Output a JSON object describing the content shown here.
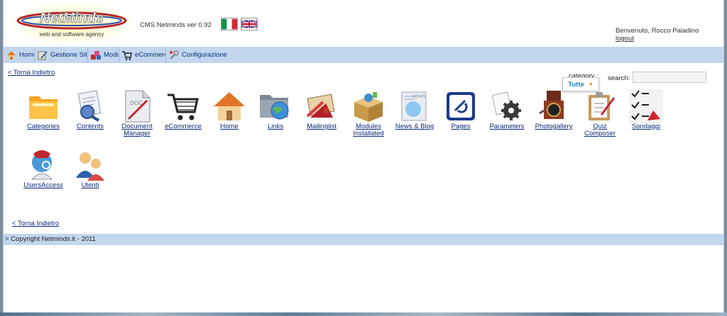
{
  "header": {
    "brand_logo_text": "NetMinds",
    "brand_tagline": "web and software agency",
    "cms_version": "CMS Netminds ver 0.92",
    "welcome_text": "Benvenuto, Rocco Paladino",
    "logout_label": "logout"
  },
  "nav": {
    "items": [
      {
        "label": "Home",
        "icon": "home-icon"
      },
      {
        "label": "Gestione Sito",
        "icon": "edit-icon"
      },
      {
        "label": "Moduli",
        "icon": "modules-icon"
      },
      {
        "label": "eCommerce",
        "icon": "cart-icon"
      },
      {
        "label": "Configurazione",
        "icon": "config-icon"
      }
    ]
  },
  "back_link": "< Torna Indietro",
  "filters": {
    "category_label": "category :",
    "category_value": "Tutte",
    "search_label": "search:",
    "search_value": ""
  },
  "modules": [
    {
      "label": "Categories",
      "icon": "folder-icon"
    },
    {
      "label": "Contents",
      "icon": "contents-icon"
    },
    {
      "label": "Document Manager",
      "icon": "document-icon"
    },
    {
      "label": "eCommerce",
      "icon": "cart-icon"
    },
    {
      "label": "Home",
      "icon": "home-icon"
    },
    {
      "label": "Links",
      "icon": "globe-folder-icon"
    },
    {
      "label": "Mailinglist",
      "icon": "mail-icon"
    },
    {
      "label": "Modules Installated",
      "icon": "box-icon"
    },
    {
      "label": "News & Blog",
      "icon": "news-icon"
    },
    {
      "label": "Pages",
      "icon": "pages-icon"
    },
    {
      "label": "Parameters",
      "icon": "gear-icon"
    },
    {
      "label": "Photogallery",
      "icon": "camera-icon"
    },
    {
      "label": "Quiz Composer",
      "icon": "clipboard-icon"
    },
    {
      "label": "Sondaggi",
      "icon": "checklist-icon"
    },
    {
      "label": "UsersAccess",
      "icon": "user-access-icon"
    },
    {
      "label": "Utenti",
      "icon": "users-icon"
    }
  ],
  "footer": {
    "copyright": "> Copyright Netminds.it - 2011"
  },
  "colors": {
    "nav_bg": "#c2d6ee",
    "link": "#0a2a7a",
    "accent": "#1d7fc1"
  }
}
